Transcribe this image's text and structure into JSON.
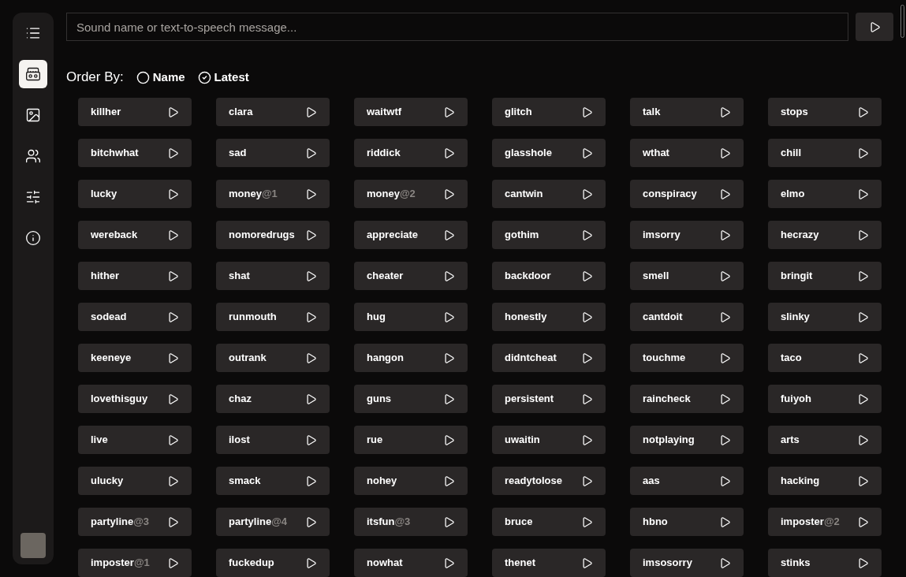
{
  "sidebar": {
    "items": [
      {
        "kind": "list",
        "selected": false
      },
      {
        "kind": "boombox",
        "selected": true
      },
      {
        "kind": "image",
        "selected": false
      },
      {
        "kind": "users",
        "selected": false
      },
      {
        "kind": "sliders",
        "selected": false
      },
      {
        "kind": "info",
        "selected": false
      }
    ]
  },
  "search": {
    "placeholder": "Sound name or text-to-speech message..."
  },
  "order_by": {
    "label": "Order By:",
    "options": [
      {
        "label": "Name",
        "selected": false
      },
      {
        "label": "Latest",
        "selected": true
      }
    ]
  },
  "sounds": [
    {
      "name": "killher"
    },
    {
      "name": "clara"
    },
    {
      "name": "waitwtf"
    },
    {
      "name": "glitch"
    },
    {
      "name": "talk"
    },
    {
      "name": "stops"
    },
    {
      "name": "bitchwhat"
    },
    {
      "name": "sad"
    },
    {
      "name": "riddick"
    },
    {
      "name": "glasshole"
    },
    {
      "name": "wthat"
    },
    {
      "name": "chill"
    },
    {
      "name": "lucky"
    },
    {
      "name": "money",
      "suffix": "@1"
    },
    {
      "name": "money",
      "suffix": "@2"
    },
    {
      "name": "cantwin"
    },
    {
      "name": "conspiracy"
    },
    {
      "name": "elmo"
    },
    {
      "name": "wereback"
    },
    {
      "name": "nomoredrugs"
    },
    {
      "name": "appreciate"
    },
    {
      "name": "gothim"
    },
    {
      "name": "imsorry"
    },
    {
      "name": "hecrazy"
    },
    {
      "name": "hither"
    },
    {
      "name": "shat"
    },
    {
      "name": "cheater"
    },
    {
      "name": "backdoor"
    },
    {
      "name": "smell"
    },
    {
      "name": "bringit"
    },
    {
      "name": "sodead"
    },
    {
      "name": "runmouth"
    },
    {
      "name": "hug"
    },
    {
      "name": "honestly"
    },
    {
      "name": "cantdoit"
    },
    {
      "name": "slinky"
    },
    {
      "name": "keeneye"
    },
    {
      "name": "outrank"
    },
    {
      "name": "hangon"
    },
    {
      "name": "didntcheat"
    },
    {
      "name": "touchme"
    },
    {
      "name": "taco"
    },
    {
      "name": "lovethisguy"
    },
    {
      "name": "chaz"
    },
    {
      "name": "guns"
    },
    {
      "name": "persistent"
    },
    {
      "name": "raincheck"
    },
    {
      "name": "fuiyoh"
    },
    {
      "name": "live"
    },
    {
      "name": "ilost"
    },
    {
      "name": "rue"
    },
    {
      "name": "uwaitin"
    },
    {
      "name": "notplaying"
    },
    {
      "name": "arts"
    },
    {
      "name": "ulucky"
    },
    {
      "name": "smack"
    },
    {
      "name": "nohey"
    },
    {
      "name": "readytolose"
    },
    {
      "name": "aas"
    },
    {
      "name": "hacking"
    },
    {
      "name": "partyline",
      "suffix": "@3"
    },
    {
      "name": "partyline",
      "suffix": "@4"
    },
    {
      "name": "itsfun",
      "suffix": "@3"
    },
    {
      "name": "bruce"
    },
    {
      "name": "hbno"
    },
    {
      "name": "imposter",
      "suffix": "@2"
    },
    {
      "name": "imposter",
      "suffix": "@1"
    },
    {
      "name": "fuckedup"
    },
    {
      "name": "nowhat"
    },
    {
      "name": "thenet"
    },
    {
      "name": "imsosorry"
    },
    {
      "name": "stinks"
    }
  ]
}
